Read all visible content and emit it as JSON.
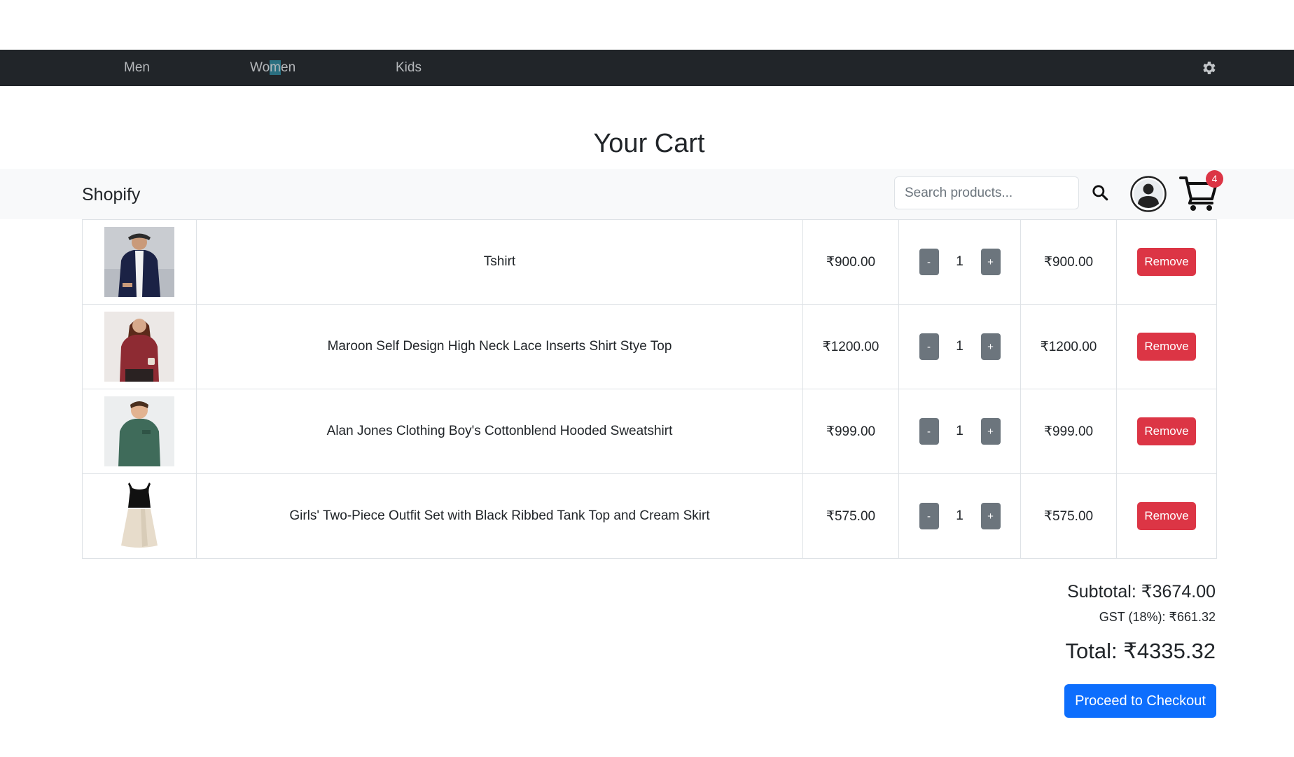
{
  "nav": {
    "items": [
      {
        "label_pre": "Wo"
      },
      {
        "label_hl": "m"
      },
      {
        "label_post": "en"
      }
    ],
    "men": "Men",
    "women_pre": "Wo",
    "women_hl": "m",
    "women_post": "en",
    "kids": "Kids",
    "settings_icon": "gear-icon"
  },
  "page": {
    "title": "Your Cart"
  },
  "brandbar": {
    "brand": "Shopify",
    "search_placeholder": "Search products...",
    "search_icon": "search-icon",
    "avatar_icon": "user-avatar-icon",
    "cart_icon": "shopping-cart-icon",
    "cart_count": "4"
  },
  "cart": {
    "items": [
      {
        "name": "Tshirt",
        "price": "₹900.00",
        "qty": "1",
        "total": "₹900.00",
        "minus": "-",
        "plus": "+",
        "remove": "Remove",
        "image": "man-navy-jacket-photo"
      },
      {
        "name": "Maroon Self Design High Neck Lace Inserts Shirt Stye Top",
        "price": "₹1200.00",
        "qty": "1",
        "total": "₹1200.00",
        "minus": "-",
        "plus": "+",
        "remove": "Remove",
        "image": "woman-maroon-top-photo"
      },
      {
        "name": "Alan Jones Clothing Boy's Cottonblend Hooded Sweatshirt",
        "price": "₹999.00",
        "qty": "1",
        "total": "₹999.00",
        "minus": "-",
        "plus": "+",
        "remove": "Remove",
        "image": "boy-green-sweatshirt-photo"
      },
      {
        "name": "Girls' Two-Piece Outfit Set with Black Ribbed Tank Top and Cream Skirt",
        "price": "₹575.00",
        "qty": "1",
        "total": "₹575.00",
        "minus": "-",
        "plus": "+",
        "remove": "Remove",
        "image": "girl-outfit-set-photo"
      }
    ]
  },
  "summary": {
    "subtotal": "Subtotal: ₹3674.00",
    "gst": "GST (18%): ₹661.32",
    "total": "Total: ₹4335.32",
    "checkout": "Proceed to Checkout"
  },
  "colors": {
    "nav_bg": "#212529",
    "brandbar_bg": "#f8f9fa",
    "danger": "#dc3545",
    "secondary": "#6c757d",
    "primary": "#0d6efd"
  }
}
